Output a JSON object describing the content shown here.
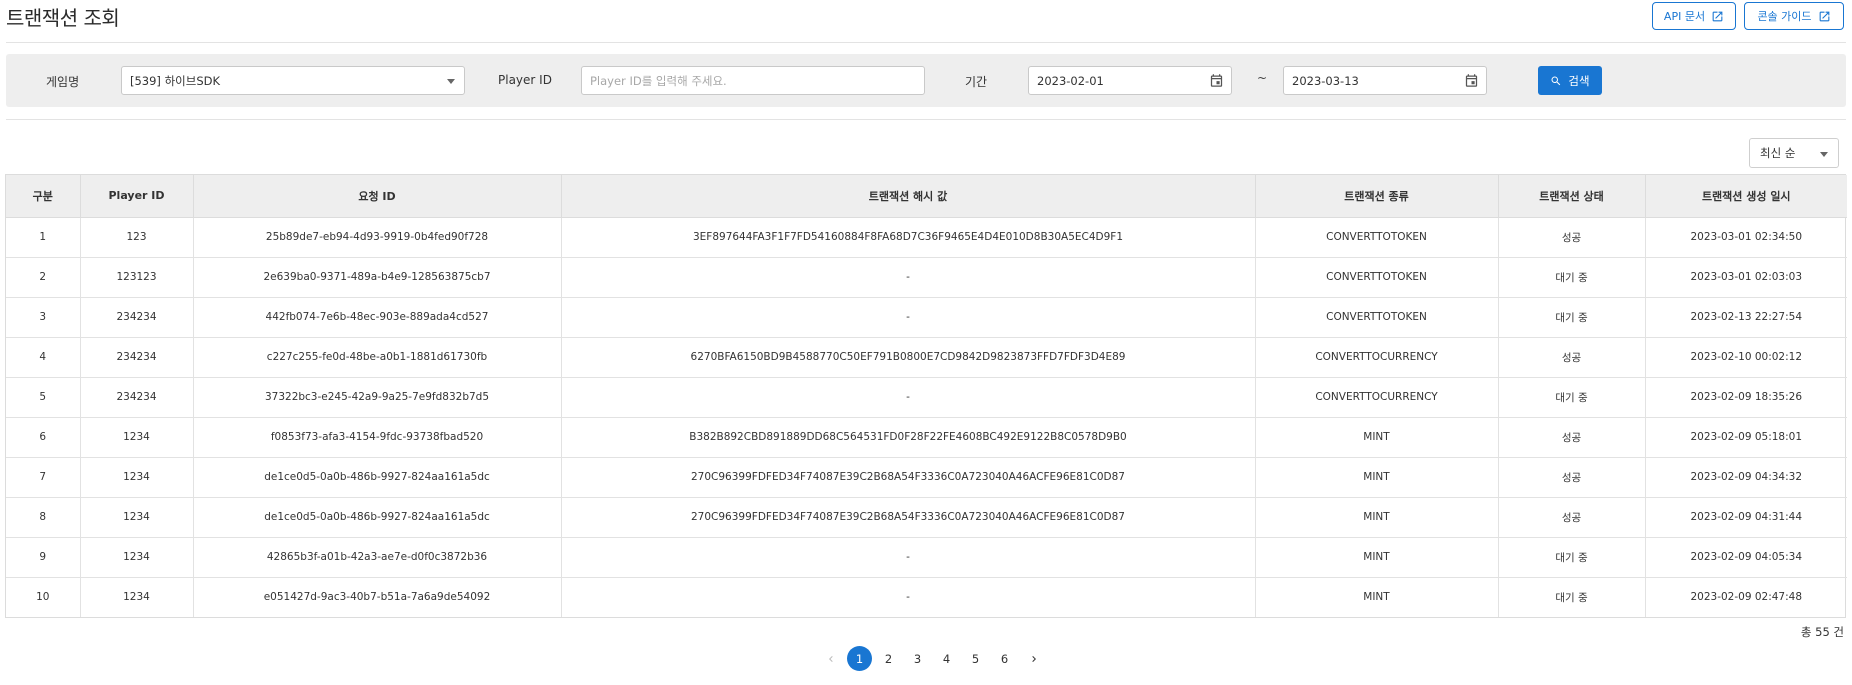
{
  "header": {
    "title": "트랜잭션 조회",
    "api_docs_label": "API 문서",
    "console_guide_label": "콘솔 가이드"
  },
  "filters": {
    "game_label": "게임명",
    "game_value": "[539] 하이브SDK",
    "player_label": "Player ID",
    "player_placeholder": "Player ID를 입력해 주세요.",
    "period_label": "기간",
    "date_from": "2023-02-01",
    "date_sep": "~",
    "date_to": "2023-03-13",
    "search_label": "검색"
  },
  "sort": {
    "value": "최신 순"
  },
  "table": {
    "columns": [
      "구분",
      "Player ID",
      "요청 ID",
      "트랜잭션 해시 값",
      "트랜잭션 종류",
      "트랜잭션 상태",
      "트랜잭션 생성 일시"
    ],
    "rows": [
      [
        "1",
        "123",
        "25b89de7-eb94-4d93-9919-0b4fed90f728",
        "3EF897644FA3F1F7FD54160884F8FA68D7C36F9465E4D4E010D8B30A5EC4D9F1",
        "CONVERTTOTOKEN",
        "성공",
        "2023-03-01 02:34:50"
      ],
      [
        "2",
        "123123",
        "2e639ba0-9371-489a-b4e9-128563875cb7",
        "-",
        "CONVERTTOTOKEN",
        "대기 중",
        "2023-03-01 02:03:03"
      ],
      [
        "3",
        "234234",
        "442fb074-7e6b-48ec-903e-889ada4cd527",
        "-",
        "CONVERTTOTOKEN",
        "대기 중",
        "2023-02-13 22:27:54"
      ],
      [
        "4",
        "234234",
        "c227c255-fe0d-48be-a0b1-1881d61730fb",
        "6270BFA6150BD9B4588770C50EF791B0800E7CD9842D9823873FFD7FDF3D4E89",
        "CONVERTTOCURRENCY",
        "성공",
        "2023-02-10 00:02:12"
      ],
      [
        "5",
        "234234",
        "37322bc3-e245-42a9-9a25-7e9fd832b7d5",
        "-",
        "CONVERTTOCURRENCY",
        "대기 중",
        "2023-02-09 18:35:26"
      ],
      [
        "6",
        "1234",
        "f0853f73-afa3-4154-9fdc-93738fbad520",
        "B382B892CBD891889DD68C564531FD0F28F22FE4608BC492E9122B8C0578D9B0",
        "MINT",
        "성공",
        "2023-02-09 05:18:01"
      ],
      [
        "7",
        "1234",
        "de1ce0d5-0a0b-486b-9927-824aa161a5dc",
        "270C96399FDFED34F74087E39C2B68A54F3336C0A723040A46ACFE96E81C0D87",
        "MINT",
        "성공",
        "2023-02-09 04:34:32"
      ],
      [
        "8",
        "1234",
        "de1ce0d5-0a0b-486b-9927-824aa161a5dc",
        "270C96399FDFED34F74087E39C2B68A54F3336C0A723040A46ACFE96E81C0D87",
        "MINT",
        "성공",
        "2023-02-09 04:31:44"
      ],
      [
        "9",
        "1234",
        "42865b3f-a01b-42a3-ae7e-d0f0c3872b36",
        "-",
        "MINT",
        "대기 중",
        "2023-02-09 04:05:34"
      ],
      [
        "10",
        "1234",
        "e051427d-9ac3-40b7-b51a-7a6a9de54092",
        "-",
        "MINT",
        "대기 중",
        "2023-02-09 02:47:48"
      ]
    ]
  },
  "summary": {
    "total": "총 55 건"
  },
  "pagination": {
    "pages": [
      "1",
      "2",
      "3",
      "4",
      "5",
      "6"
    ],
    "active": "1"
  },
  "colors": {
    "accent": "#1976d2",
    "panel_bg": "#eeeeee"
  },
  "icons": [
    "external-link-icon",
    "calendar-icon",
    "search-icon",
    "chevron-left-icon",
    "chevron-right-icon",
    "caret-down-icon"
  ]
}
